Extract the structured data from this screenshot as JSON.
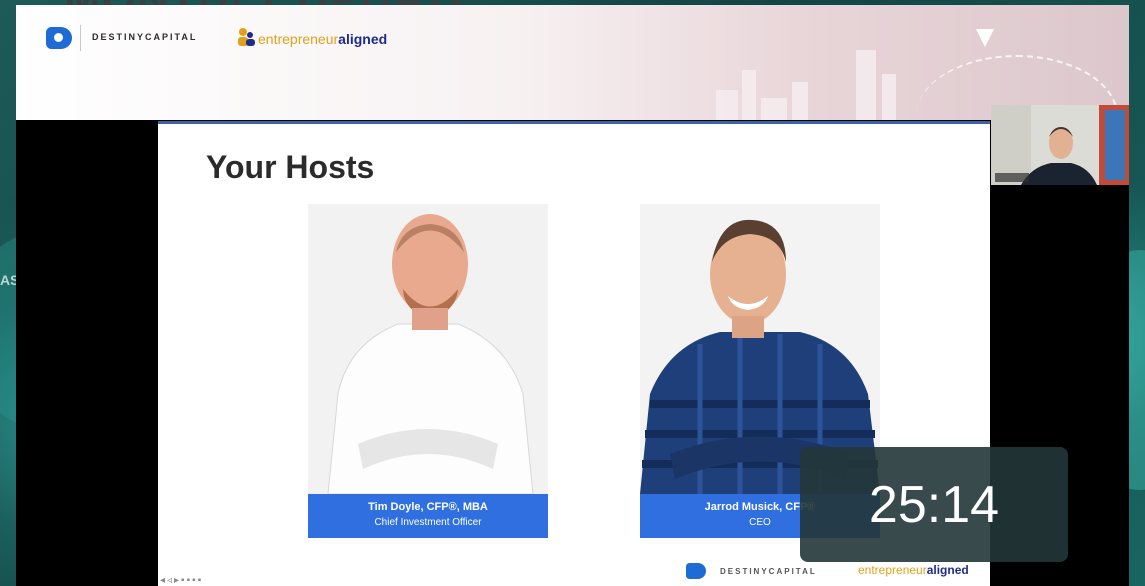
{
  "background": {
    "top_text": "MONTHLY UPDATE",
    "side_text": "AS"
  },
  "banner": {
    "brand_name": "DESTINYCAPITAL",
    "partner_prefix": "entrepreneur",
    "partner_suffix": "aligned"
  },
  "slide": {
    "title": "Your Hosts",
    "hosts": [
      {
        "name": "Tim Doyle, CFP®, MBA",
        "role": "Chief Investment Officer"
      },
      {
        "name": "Jarrod Musick, CFP®",
        "role": "CEO"
      }
    ],
    "footer_brand": "DESTINYCAPITAL",
    "footer_partner_prefix": "entrepreneur",
    "footer_partner_suffix": "aligned"
  },
  "timer": {
    "value": "25:14"
  },
  "colors": {
    "accent_blue": "#2f6fe0",
    "brand_blue": "#1e6bd6",
    "teal": "#1d5a58"
  }
}
